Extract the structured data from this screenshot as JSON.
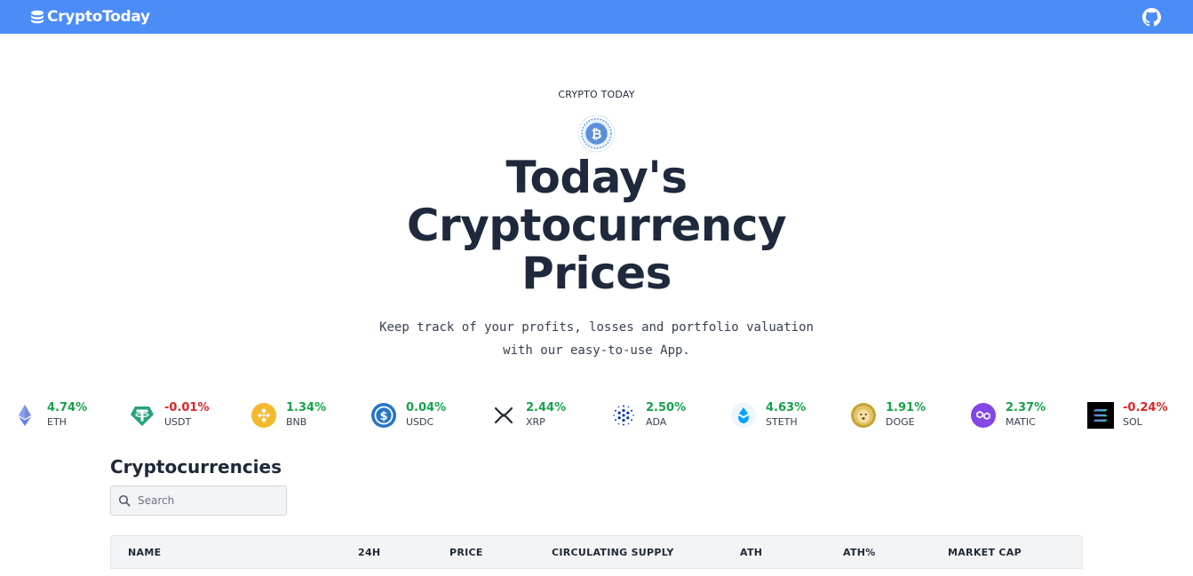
{
  "nav": {
    "brand": "CryptoToday",
    "github_icon": "github-icon",
    "brand_color": "#4b8cf7"
  },
  "hero": {
    "eyebrow": "CRYPTO TODAY",
    "logo_icon": "bitcoin-coin-icon",
    "title_lines": [
      "Today's",
      "Cryptocurrency",
      "Prices"
    ],
    "subtitle_lines": [
      "Keep track of your profits, losses and portfolio valuation",
      "with our easy-to-use App."
    ]
  },
  "ticker": [
    {
      "symbol": "ETH",
      "change": "4.74%",
      "direction": "up",
      "icon": "ethereum-icon"
    },
    {
      "symbol": "USDT",
      "change": "-0.01%",
      "direction": "down",
      "icon": "tether-icon"
    },
    {
      "symbol": "BNB",
      "change": "1.34%",
      "direction": "up",
      "icon": "bnb-icon"
    },
    {
      "symbol": "USDC",
      "change": "0.04%",
      "direction": "up",
      "icon": "usdc-icon"
    },
    {
      "symbol": "XRP",
      "change": "2.44%",
      "direction": "up",
      "icon": "xrp-icon"
    },
    {
      "symbol": "ADA",
      "change": "2.50%",
      "direction": "up",
      "icon": "cardano-icon"
    },
    {
      "symbol": "STETH",
      "change": "4.63%",
      "direction": "up",
      "icon": "lido-steth-icon"
    },
    {
      "symbol": "DOGE",
      "change": "1.91%",
      "direction": "up",
      "icon": "dogecoin-icon"
    },
    {
      "symbol": "MATIC",
      "change": "2.37%",
      "direction": "up",
      "icon": "polygon-icon"
    },
    {
      "symbol": "SOL",
      "change": "-0.24%",
      "direction": "down",
      "icon": "solana-icon"
    }
  ],
  "colors": {
    "up": "#16a34a",
    "down": "#dc2626"
  },
  "crypto_table": {
    "title": "Cryptocurrencies",
    "search_placeholder": "Search",
    "search_icon": "search-icon",
    "columns": [
      "NAME",
      "24H",
      "PRICE",
      "CIRCULATING SUPPLY",
      "ATH",
      "ATH%",
      "MARKET CAP"
    ]
  }
}
